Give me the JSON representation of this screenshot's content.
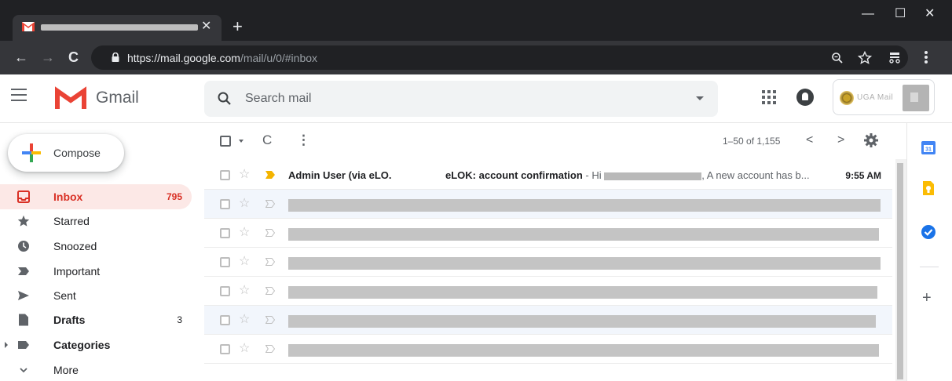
{
  "browser": {
    "new_tab": "+",
    "tab_close": "✕",
    "controls": {
      "minimize": "—",
      "maximize": "☐",
      "close": "✕"
    },
    "nav": {
      "back": "←",
      "forward": "→",
      "reload": "C"
    },
    "url_host": "https://mail.google.com",
    "url_path": "/mail/u/0/#inbox",
    "icons": [
      "zoom-icon",
      "bookmark-star-icon",
      "extension-icon",
      "menu-icon"
    ]
  },
  "header": {
    "brand": "Gmail",
    "search_placeholder": "Search mail",
    "account_org": "UGA Mail"
  },
  "colors": {
    "accent": "#d93025",
    "gmail_red": "#ea4335",
    "selected_row": "#f2f6fc",
    "important": "#f4b400"
  },
  "sidebar": {
    "compose": "Compose",
    "items": [
      {
        "label": "Inbox",
        "count": "795",
        "active": true
      },
      {
        "label": "Starred",
        "count": ""
      },
      {
        "label": "Snoozed",
        "count": ""
      },
      {
        "label": "Important",
        "count": ""
      },
      {
        "label": "Sent",
        "count": ""
      },
      {
        "label": "Drafts",
        "count": "3"
      },
      {
        "label": "Categories",
        "count": ""
      },
      {
        "label": "More",
        "count": ""
      }
    ]
  },
  "toolbar": {
    "refresh": "C",
    "more": "⋮",
    "range": "1–50 of 1,155",
    "prev": "<",
    "next": ">"
  },
  "emails": [
    {
      "sender": "Admin User (via eLO.",
      "subject": "eLOK: account confirmation",
      "snippet_start": " - Hi ",
      "snippet_end": ", A new account has b...",
      "time": "9:55 AM",
      "unread": true,
      "important": true
    },
    {
      "redacted": true
    },
    {
      "redacted": true
    },
    {
      "redacted": true
    },
    {
      "redacted": true
    },
    {
      "redacted": true
    },
    {
      "redacted": true
    }
  ]
}
